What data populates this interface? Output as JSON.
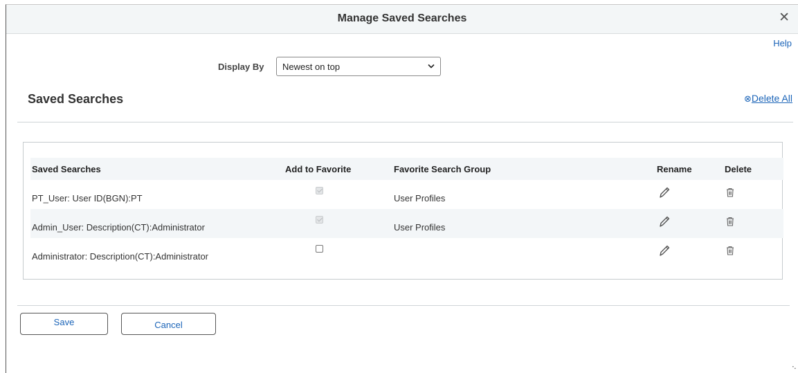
{
  "dialog": {
    "title": "Manage Saved Searches",
    "close_icon": "close-icon",
    "help_label": "Help"
  },
  "display_by": {
    "label": "Display By",
    "selected": "Newest on top"
  },
  "section": {
    "title": "Saved Searches",
    "delete_all_label": "Delete All",
    "delete_all_icon": "circle-x-icon"
  },
  "grid": {
    "columns": [
      "Saved Searches",
      "Add to Favorite",
      "Favorite Search Group",
      "Rename",
      "Delete"
    ],
    "rows": [
      {
        "name": "PT_User: User ID(BGN):PT",
        "favorite": true,
        "group": "User Profiles"
      },
      {
        "name": "Admin_User: Description(CT):Administrator",
        "favorite": true,
        "group": "User Profiles"
      },
      {
        "name": "Administrator: Description(CT):Administrator",
        "favorite": false,
        "group": ""
      }
    ]
  },
  "buttons": {
    "save_label": "Save",
    "cancel_label": "Cancel"
  },
  "colors": {
    "link": "#1b64b8",
    "header_bg": "#f3f6f7"
  }
}
